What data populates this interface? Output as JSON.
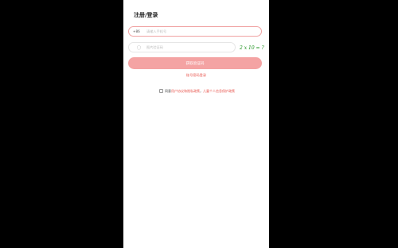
{
  "page": {
    "title": "注册/登录"
  },
  "phone_field": {
    "country_code": "+86",
    "placeholder": "请输入手机号",
    "value": ""
  },
  "captcha_field": {
    "placeholder": "图片验证码",
    "value": "",
    "icon": "shield-icon",
    "captcha_text": "2 x 10 = ?"
  },
  "submit_button": {
    "label": "获取验证码"
  },
  "password_login_link": {
    "label": "账号密码登录"
  },
  "agreement": {
    "prefix": "同意",
    "user_agreement": "用户协议",
    "conjunction": "和",
    "privacy_policy": "隐私政策",
    "separator": "，",
    "child_policy": "儿童个人信息保护政策",
    "checked": false
  },
  "colors": {
    "accent": "#f4a3a3",
    "link": "#e8564f",
    "captcha_text": "#1a8f1a",
    "background_outside": "#000000"
  }
}
